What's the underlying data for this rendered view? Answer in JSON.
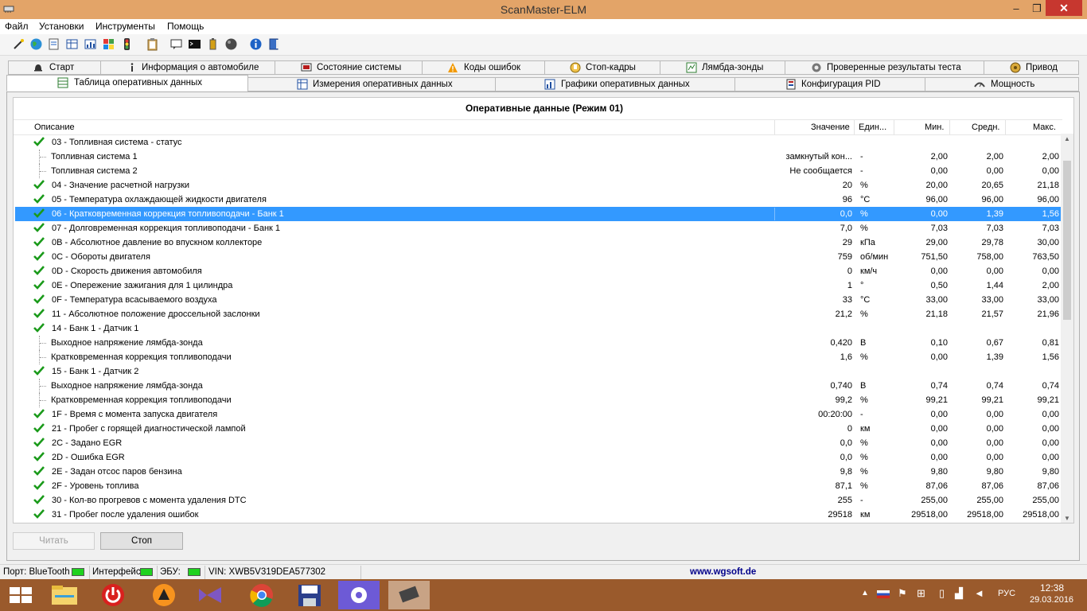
{
  "window": {
    "title": "ScanMaster-ELM",
    "minimize": "–",
    "maximize": "❐",
    "close": "✕"
  },
  "menu": [
    "Файл",
    "Установки",
    "Инструменты",
    "Помощь"
  ],
  "toolbar_icons": [
    "wizard-icon",
    "globe-icon",
    "document-icon",
    "table-icon",
    "chart-icon",
    "palette-icon",
    "traffic-light-icon",
    "clipboard-icon",
    "chat-icon",
    "terminal-icon",
    "battery-icon",
    "sphere-icon",
    "info-icon",
    "book-icon"
  ],
  "tabs_row1": [
    {
      "label": "Старт",
      "icon": "bell-icon"
    },
    {
      "label": "Информация о автомобиле",
      "icon": "info-icon"
    },
    {
      "label": "Состояние системы",
      "icon": "monitor-icon"
    },
    {
      "label": "Коды ошибок",
      "icon": "warning-icon"
    },
    {
      "label": "Стоп-кадры",
      "icon": "hand-icon"
    },
    {
      "label": "Лямбда-зонды",
      "icon": "sensor-icon"
    },
    {
      "label": "Проверенные результаты теста",
      "icon": "gear-icon"
    },
    {
      "label": "Привод",
      "icon": "drive-icon"
    }
  ],
  "tabs_row2": [
    {
      "label": "Таблица оперативных данных",
      "icon": "table-icon",
      "active": true
    },
    {
      "label": "Измерения оперативных данных",
      "icon": "grid-icon"
    },
    {
      "label": "Графики оперативных данных",
      "icon": "chart-icon"
    },
    {
      "label": "Конфигурация PID",
      "icon": "config-icon"
    },
    {
      "label": "Мощность",
      "icon": "power-icon"
    }
  ],
  "grid": {
    "title": "Оперативные данные (Режим 01)",
    "columns": {
      "desc": "Описание",
      "value": "Значение",
      "unit": "Един...",
      "min": "Мин.",
      "avg": "Средн.",
      "max": "Макс."
    },
    "rows": [
      {
        "desc": "03 - Топливная система - статус",
        "value": "",
        "unit": "",
        "min": "",
        "avg": "",
        "max": "",
        "check": true
      },
      {
        "desc": "Топливная система 1",
        "value": "замкнутый кон...",
        "unit": "-",
        "min": "2,00",
        "avg": "2,00",
        "max": "2,00",
        "child": true
      },
      {
        "desc": "Топливная система 2",
        "value": "Не сообщается",
        "unit": "-",
        "min": "0,00",
        "avg": "0,00",
        "max": "0,00",
        "child": true
      },
      {
        "desc": "04 - Значение расчетной нагрузки",
        "value": "20",
        "unit": "%",
        "min": "20,00",
        "avg": "20,65",
        "max": "21,18",
        "check": true
      },
      {
        "desc": "05 - Температура охлаждающей жидкости двигателя",
        "value": "96",
        "unit": "°C",
        "min": "96,00",
        "avg": "96,00",
        "max": "96,00",
        "check": true
      },
      {
        "desc": "06 - Кратковременная коррекция топливоподачи - Банк 1",
        "value": "0,0",
        "unit": "%",
        "min": "0,00",
        "avg": "1,39",
        "max": "1,56",
        "check": true,
        "selected": true
      },
      {
        "desc": "07 - Долговременная коррекция топливоподачи - Банк 1",
        "value": "7,0",
        "unit": "%",
        "min": "7,03",
        "avg": "7,03",
        "max": "7,03",
        "check": true
      },
      {
        "desc": "0B - Абсолютное давление во впускном коллекторе",
        "value": "29",
        "unit": "кПа",
        "min": "29,00",
        "avg": "29,78",
        "max": "30,00",
        "check": true
      },
      {
        "desc": "0C - Обороты двигателя",
        "value": "759",
        "unit": "об/мин",
        "min": "751,50",
        "avg": "758,00",
        "max": "763,50",
        "check": true
      },
      {
        "desc": "0D - Скорость движения автомобиля",
        "value": "0",
        "unit": "км/ч",
        "min": "0,00",
        "avg": "0,00",
        "max": "0,00",
        "check": true
      },
      {
        "desc": "0E - Опережение зажигания для 1 цилиндра",
        "value": "1",
        "unit": "°",
        "min": "0,50",
        "avg": "1,44",
        "max": "2,00",
        "check": true
      },
      {
        "desc": "0F - Температура всасываемого воздуха",
        "value": "33",
        "unit": "°C",
        "min": "33,00",
        "avg": "33,00",
        "max": "33,00",
        "check": true
      },
      {
        "desc": "11 - Абсолютное положение дроссельной заслонки",
        "value": "21,2",
        "unit": "%",
        "min": "21,18",
        "avg": "21,57",
        "max": "21,96",
        "check": true
      },
      {
        "desc": "14 - Банк 1 - Датчик 1",
        "value": "",
        "unit": "",
        "min": "",
        "avg": "",
        "max": "",
        "check": true
      },
      {
        "desc": "Выходное напряжение лямбда-зонда",
        "value": "0,420",
        "unit": "В",
        "min": "0,10",
        "avg": "0,67",
        "max": "0,81",
        "child": true
      },
      {
        "desc": "Кратковременная коррекция топливоподачи",
        "value": "1,6",
        "unit": "%",
        "min": "0,00",
        "avg": "1,39",
        "max": "1,56",
        "child": true
      },
      {
        "desc": "15 - Банк 1 - Датчик 2",
        "value": "",
        "unit": "",
        "min": "",
        "avg": "",
        "max": "",
        "check": true
      },
      {
        "desc": "Выходное напряжение лямбда-зонда",
        "value": "0,740",
        "unit": "В",
        "min": "0,74",
        "avg": "0,74",
        "max": "0,74",
        "child": true
      },
      {
        "desc": "Кратковременная коррекция топливоподачи",
        "value": "99,2",
        "unit": "%",
        "min": "99,21",
        "avg": "99,21",
        "max": "99,21",
        "child": true
      },
      {
        "desc": "1F - Время с момента запуска двигателя",
        "value": "00:20:00",
        "unit": "-",
        "min": "0,00",
        "avg": "0,00",
        "max": "0,00",
        "check": true
      },
      {
        "desc": "21 - Пробег с горящей диагностической лампой",
        "value": "0",
        "unit": "км",
        "min": "0,00",
        "avg": "0,00",
        "max": "0,00",
        "check": true
      },
      {
        "desc": "2C - Задано EGR",
        "value": "0,0",
        "unit": "%",
        "min": "0,00",
        "avg": "0,00",
        "max": "0,00",
        "check": true
      },
      {
        "desc": "2D - Ошибка EGR",
        "value": "0,0",
        "unit": "%",
        "min": "0,00",
        "avg": "0,00",
        "max": "0,00",
        "check": true
      },
      {
        "desc": "2E - Задан отсос паров бензина",
        "value": "9,8",
        "unit": "%",
        "min": "9,80",
        "avg": "9,80",
        "max": "9,80",
        "check": true
      },
      {
        "desc": "2F - Уровень топлива",
        "value": "87,1",
        "unit": "%",
        "min": "87,06",
        "avg": "87,06",
        "max": "87,06",
        "check": true
      },
      {
        "desc": "30 - Кол-во прогревов с момента удаления DTC",
        "value": "255",
        "unit": "-",
        "min": "255,00",
        "avg": "255,00",
        "max": "255,00",
        "check": true
      },
      {
        "desc": "31 - Пробег после удаления ошибок",
        "value": "29518",
        "unit": "км",
        "min": "29518,00",
        "avg": "29518,00",
        "max": "29518,00",
        "check": true
      }
    ]
  },
  "buttons": {
    "read": "Читать",
    "stop": "Стоп"
  },
  "status": {
    "port": "Порт: BlueTooth",
    "interface": "Интерфейс:",
    "ecu": "ЭБУ:",
    "vin": "VIN: XWB5V319DEA577302",
    "site": "www.wgsoft.de",
    "led_color": "#1fd21f"
  },
  "taskbar": {
    "apps": [
      "windows-start-icon",
      "file-explorer-icon",
      "power-app-icon",
      "avast-icon",
      "visual-studio-icon",
      "chrome-icon",
      "save-disk-icon",
      "settings-gear-icon",
      "chip-icon"
    ],
    "lang": "РУС",
    "time": "12:38",
    "date": "29.03.2016"
  }
}
